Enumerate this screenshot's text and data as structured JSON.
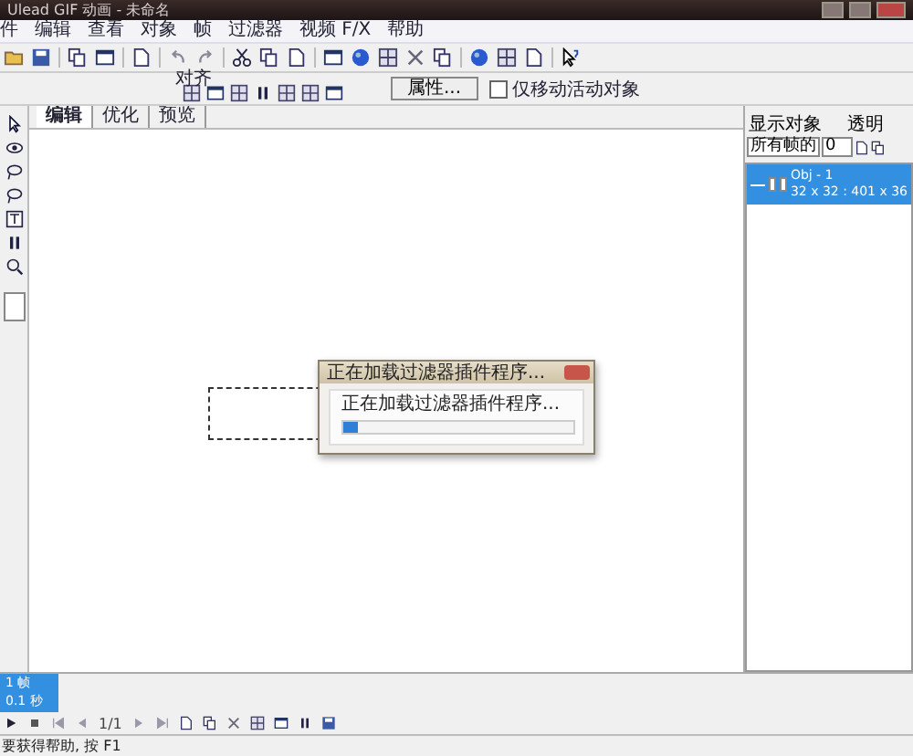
{
  "window": {
    "title": "Ulead GIF 动画 - 未命名"
  },
  "menu": [
    "件",
    "编辑",
    "查看",
    "对象",
    "帧",
    "过滤器",
    "视频 F/X",
    "帮助"
  ],
  "attribute_bar": {
    "label": "对齐",
    "properties_button": "属性...",
    "checkbox": {
      "label": "仅移动活动对象",
      "checked": false
    }
  },
  "tabs": [
    {
      "label": "编辑",
      "selected": true
    },
    {
      "label": "优化",
      "selected": false
    },
    {
      "label": "预览",
      "selected": false
    }
  ],
  "object_panel": {
    "display_label": "显示对象",
    "opacity_label": "透明",
    "display_select": "所有帧的",
    "opacity_value": "0",
    "objects": [
      {
        "name": "Obj - 1",
        "info": "32 x 32 : 401 x 36",
        "selected": true
      }
    ]
  },
  "dialog": {
    "title": "正在加载过滤器插件程序...",
    "message": "正在加载过滤器插件程序...",
    "level": 0.06
  },
  "frames": [
    {
      "label": "1 帧",
      "delay": "0.1 秒",
      "selected": true
    }
  ],
  "frame_counter": "1/1",
  "status_bar": "要获得帮助, 按 F1"
}
